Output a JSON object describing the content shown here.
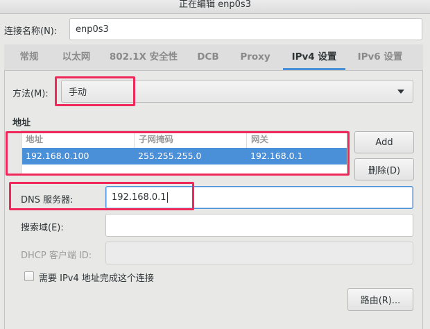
{
  "window": {
    "title": "正在编辑 enp0s3"
  },
  "connection_name": {
    "label": "连接名称(N):",
    "value": "enp0s3"
  },
  "tabs": [
    {
      "label": "常规"
    },
    {
      "label": "以太网"
    },
    {
      "label": "802.1X 安全性"
    },
    {
      "label": "DCB"
    },
    {
      "label": "Proxy"
    },
    {
      "label": "IPv4 设置"
    },
    {
      "label": "IPv6 设置"
    }
  ],
  "active_tab": "IPv4 设置",
  "method": {
    "label": "方法(M):",
    "value": "手动"
  },
  "addresses": {
    "section_title": "地址",
    "columns": [
      "地址",
      "子网掩码",
      "网关"
    ],
    "rows": [
      [
        "192.168.0.100",
        "255.255.255.0",
        "192.168.0.1"
      ]
    ],
    "add_label": "Add",
    "delete_label": "删除(D)"
  },
  "dns": {
    "label": "DNS 服务器:",
    "value": "192.168.0.1"
  },
  "search_domains": {
    "label": "搜索域(E):",
    "value": ""
  },
  "dhcp_client_id": {
    "label": "DHCP 客户端 ID:",
    "value": ""
  },
  "require_ipv4": {
    "label": "需要 IPv4 地址完成这个连接",
    "checked": false
  },
  "routes_button": {
    "label": "路由(R)..."
  },
  "colors": {
    "accent": "#4a90d9",
    "highlight_box": "#f0285a"
  }
}
